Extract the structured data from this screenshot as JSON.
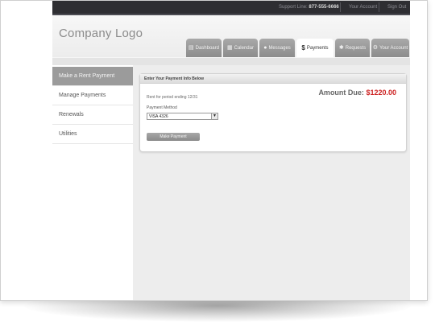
{
  "topbar": {
    "support_label": "Support Line:",
    "support_phone": "877-555-6666",
    "your_account": "Your Account",
    "sign_out": "Sign Out"
  },
  "header": {
    "logo": "Company Logo"
  },
  "tabs": [
    {
      "label": "Dashboard",
      "icon": "dashboard-icon",
      "active": false
    },
    {
      "label": "Calendar",
      "icon": "calendar-icon",
      "active": false
    },
    {
      "label": "Messages",
      "icon": "messages-icon",
      "active": false
    },
    {
      "label": "Payments",
      "icon": "dollar-icon",
      "active": true
    },
    {
      "label": "Requests",
      "icon": "tools-icon",
      "active": false
    },
    {
      "label": "Your Account",
      "icon": "account-icon",
      "active": false
    }
  ],
  "sidebar": {
    "items": [
      {
        "label": "Make a Rent Payment",
        "active": true
      },
      {
        "label": "Manage Payments",
        "active": false
      },
      {
        "label": "Renewals",
        "active": false
      },
      {
        "label": "Utilities",
        "active": false
      }
    ]
  },
  "panel": {
    "title": "Enter Your Payment Info Below",
    "amount_label": "Amount Due:",
    "amount_value": "$1220.00",
    "rent_period": "Rent for period ending 12/31",
    "payment_method_label": "Payment Method",
    "payment_method_value": "VISA 4326",
    "submit_label": "Make Payment"
  },
  "colors": {
    "topbar_bg": "#2e2e32",
    "amount_color": "#cc2020",
    "active_sidebar": "#9b9b9b"
  }
}
